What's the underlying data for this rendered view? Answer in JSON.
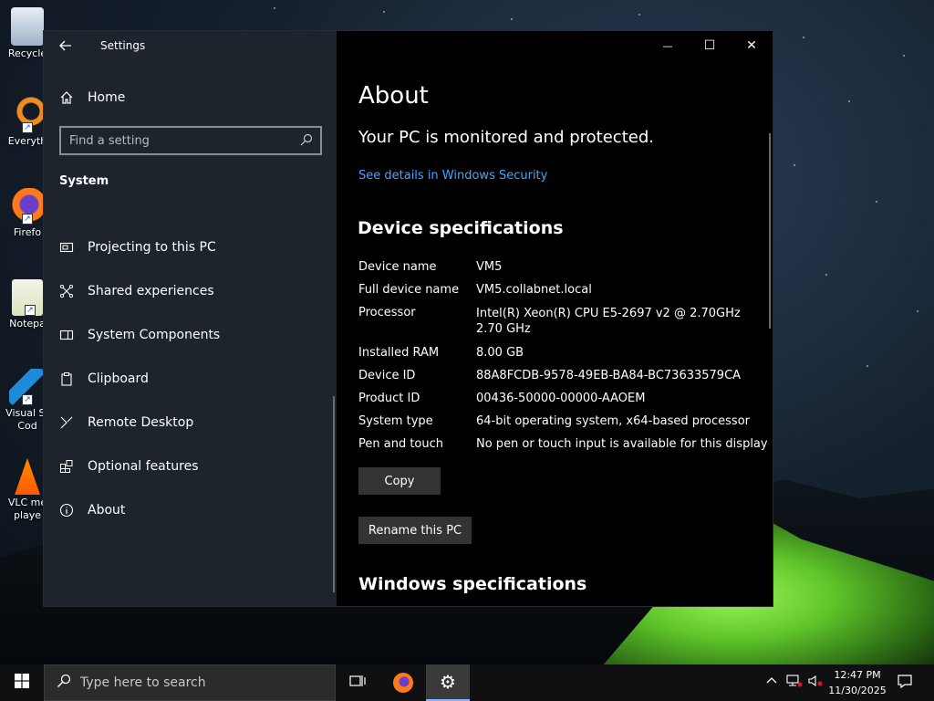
{
  "desktop": {
    "icons": [
      {
        "label": "Recycle"
      },
      {
        "label": "Everyth"
      },
      {
        "label": "Firefo"
      },
      {
        "label": "Notepa"
      },
      {
        "label": "Visual St\nCod"
      },
      {
        "label": "VLC me\nplaye"
      }
    ]
  },
  "window": {
    "app_title": "Settings",
    "controls": {
      "minimize": "—",
      "maximize": "☐",
      "close": "✕"
    }
  },
  "nav": {
    "home_label": "Home",
    "search": {
      "placeholder": "Find a setting"
    },
    "section": "System",
    "items": [
      {
        "label": "Projecting to this PC"
      },
      {
        "label": "Shared experiences"
      },
      {
        "label": "System Components"
      },
      {
        "label": "Clipboard"
      },
      {
        "label": "Remote Desktop"
      },
      {
        "label": "Optional features"
      },
      {
        "label": "About"
      }
    ]
  },
  "about": {
    "title": "About",
    "protection": "Your PC is monitored and protected.",
    "security_link": "See details in Windows Security",
    "device_heading": "Device specifications",
    "specs": [
      {
        "key": "Device name",
        "value": "VM5"
      },
      {
        "key": "Full device name",
        "value": "VM5.collabnet.local"
      },
      {
        "key": "Processor",
        "value": "Intel(R) Xeon(R) CPU E5-2697 v2 @ 2.70GHz\n2.70 GHz"
      },
      {
        "key": "Installed RAM",
        "value": "8.00 GB"
      },
      {
        "key": "Device ID",
        "value": "88A8FCDB-9578-49EB-BA84-BC73633579CA"
      },
      {
        "key": "Product ID",
        "value": "00436-50000-00000-AAOEM"
      },
      {
        "key": "System type",
        "value": "64-bit operating system, x64-based processor"
      },
      {
        "key": "Pen and touch",
        "value": "No pen or touch input is available for this display"
      }
    ],
    "copy_label": "Copy",
    "rename_label": "Rename this PC",
    "windows_heading": "Windows specifications"
  },
  "taskbar": {
    "search_placeholder": "Type here to search",
    "time": "12:47 PM",
    "date": "11/30/2025"
  },
  "colors": {
    "accent_link": "#4aa3ff",
    "nav_bg": "#20262e",
    "content_bg": "#000000",
    "taskbar_bg": "#101012",
    "button_bg": "#333333"
  }
}
